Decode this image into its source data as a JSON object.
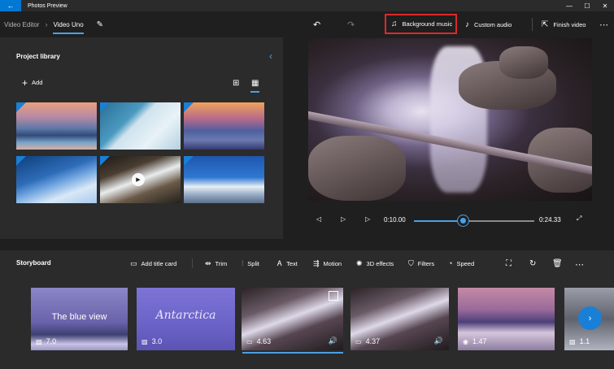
{
  "titlebar": {
    "title": "Photos Preview",
    "back": "←",
    "minimize": "—",
    "maximize": "☐",
    "close": "✕"
  },
  "cmdbar": {
    "crumb_parent": "Video Editor",
    "crumb_current": "Video Uno",
    "background_music": "Background music",
    "custom_audio": "Custom audio",
    "finish_video": "Finish video"
  },
  "library": {
    "title": "Project library",
    "add": "Add"
  },
  "player": {
    "current_time": "0:10.00",
    "total_time": "0:24.33",
    "progress": 0.41
  },
  "storyboard": {
    "title": "Storyboard",
    "tools": {
      "add_title_card": "Add title card",
      "trim": "Trim",
      "split": "Split",
      "text": "Text",
      "motion": "Motion",
      "effects_3d": "3D effects",
      "filters": "Filters",
      "speed": "Speed"
    },
    "clips": [
      {
        "text": "The blue view",
        "duration": "7.0"
      },
      {
        "text": "Antarctica",
        "duration": "3.0"
      },
      {
        "text": "",
        "duration": "4.63"
      },
      {
        "text": "",
        "duration": "4.37"
      },
      {
        "text": "",
        "duration": "1.47"
      },
      {
        "text": "",
        "duration": "1.1"
      }
    ]
  },
  "colors": {
    "accent": "#4aa0e6",
    "highlight_box": "#e0282a",
    "panel": "#2b2b2b",
    "background": "#1f1f1f"
  }
}
